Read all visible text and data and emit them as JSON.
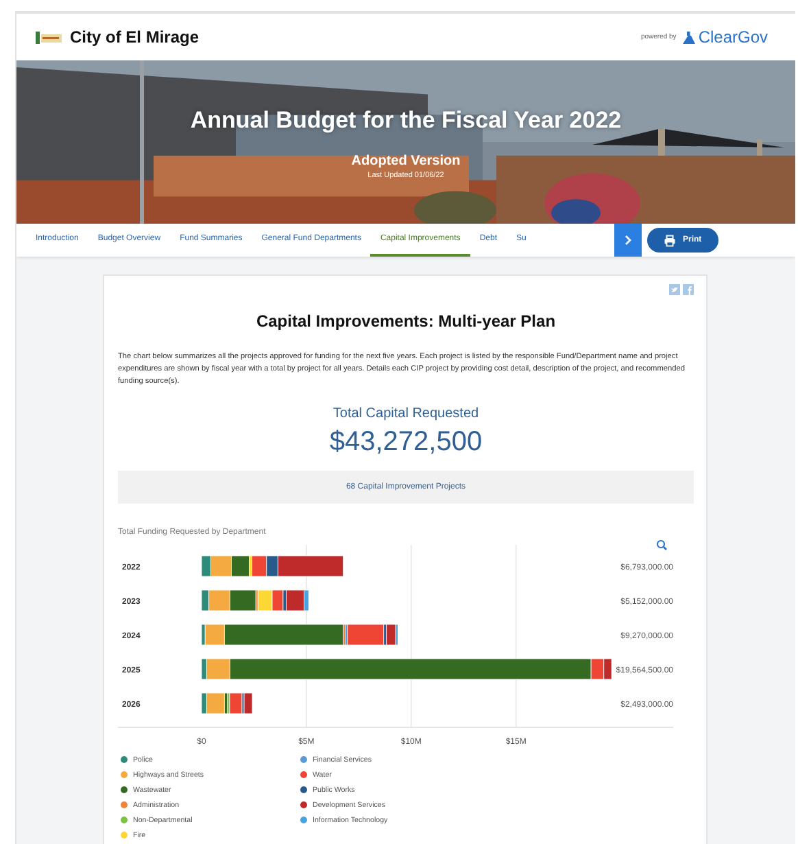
{
  "header": {
    "city_name": "City of El Mirage",
    "powered_by": "powered by",
    "brand": "ClearGov"
  },
  "banner": {
    "title": "Annual Budget for the Fiscal Year 2022",
    "version": "Adopted Version",
    "updated": "Last Updated 01/06/22"
  },
  "tabs": [
    {
      "label": "Introduction",
      "selected": false
    },
    {
      "label": "Budget Overview",
      "selected": false
    },
    {
      "label": "Fund Summaries",
      "selected": false
    },
    {
      "label": "General Fund Departments",
      "selected": false
    },
    {
      "label": "Capital Improvements",
      "selected": true
    },
    {
      "label": "Debt",
      "selected": false
    },
    {
      "label": "Su",
      "selected": false
    }
  ],
  "print_button": "Print",
  "card": {
    "title": "Capital Improvements: Multi-year Plan",
    "description": "The chart below summarizes all the projects approved for funding for the next five years. Each project is listed by the responsible Fund/Department name and project expenditures are shown by fiscal year with a total by project for all years. Details each CIP project by providing cost detail, description of the project, and recommended funding source(s).",
    "total_label": "Total Capital Requested",
    "total_value": "$43,272,500",
    "project_count": "68 Capital Improvement Projects",
    "chart_title": "Total Funding Requested by Department",
    "row_totals": [
      "$6,793,000.00",
      "$5,152,000.00",
      "$9,270,000.00",
      "$19,564,500.00",
      "$2,493,000.00"
    ],
    "chart_data": {
      "type": "bar",
      "orientation": "horizontal",
      "stacked": true,
      "categories": [
        "2022",
        "2023",
        "2024",
        "2025",
        "2026"
      ],
      "xlim": [
        0,
        22.5
      ],
      "grid": true,
      "xticks": [
        {
          "value": 0,
          "label": "$0"
        },
        {
          "value": 5,
          "label": "$5M"
        },
        {
          "value": 10,
          "label": "$10M"
        },
        {
          "value": 15,
          "label": "$15M"
        }
      ],
      "series": [
        {
          "name": "Police",
          "color": "#2e8b7a",
          "values": [
            0.44,
            0.35,
            0.17,
            0.24,
            0.24
          ]
        },
        {
          "name": "Highways and Streets",
          "color": "#f4a941",
          "values": [
            0.98,
            1.0,
            0.92,
            1.11,
            0.85
          ]
        },
        {
          "name": "Wastewater",
          "color": "#356a22",
          "values": [
            0.85,
            1.24,
            5.66,
            17.23,
            0.15
          ]
        },
        {
          "name": "Administration",
          "color": "#f0833a",
          "values": [
            0,
            0.1,
            0.1,
            0,
            0
          ]
        },
        {
          "name": "Non-Departmental",
          "color": "#7cc144",
          "values": [
            0,
            0,
            0,
            0,
            0.1
          ]
        },
        {
          "name": "Fire",
          "color": "#fdd835",
          "values": [
            0.13,
            0.68,
            0,
            0,
            0
          ]
        },
        {
          "name": "Financial Services",
          "color": "#5b9bd5",
          "values": [
            0,
            0,
            0.1,
            0,
            0
          ]
        },
        {
          "name": "Water",
          "color": "#ee4535",
          "values": [
            0.7,
            0.52,
            1.74,
            0.61,
            0.59
          ]
        },
        {
          "name": "Public Works",
          "color": "#285a8a",
          "values": [
            0.54,
            0.15,
            0.13,
            0,
            0.1
          ]
        },
        {
          "name": "Development Services",
          "color": "#bf2a2a",
          "values": [
            3.12,
            0.85,
            0.44,
            0.37,
            0.39
          ]
        },
        {
          "name": "Information Technology",
          "color": "#4aa3df",
          "values": [
            0,
            0.22,
            0.11,
            0,
            0
          ]
        }
      ]
    }
  }
}
